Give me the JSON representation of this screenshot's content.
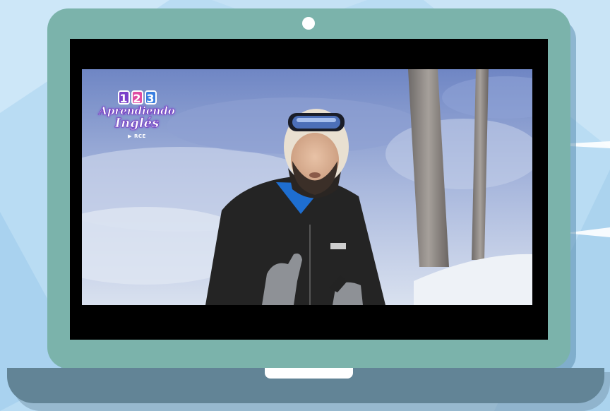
{
  "colors": {
    "background": "#b9dcf3",
    "laptop_lid": "#7bb3ab",
    "laptop_base": "#628496",
    "screen": "#000000",
    "webcam": "#ffffff"
  },
  "video": {
    "channel_logo": {
      "numbers": [
        "1",
        "2",
        "3"
      ],
      "word1": "Aprendiendo",
      "word2": "Inglés",
      "sub": "▶ RCE"
    }
  }
}
